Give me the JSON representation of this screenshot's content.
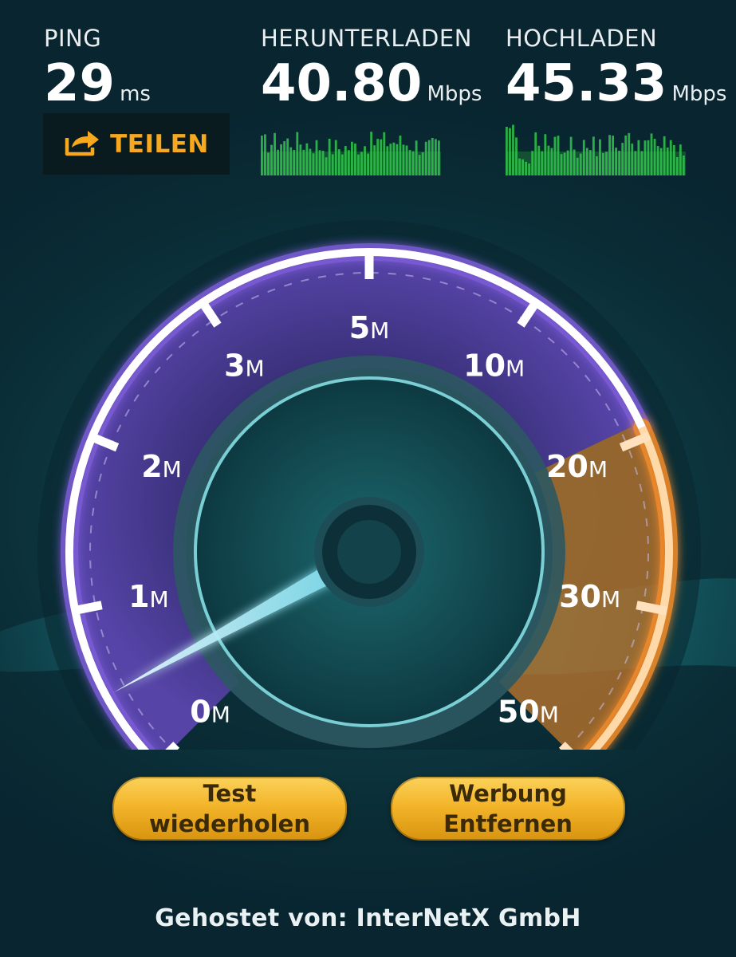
{
  "header": {
    "ping": {
      "label": "PING",
      "value": "29",
      "unit": "ms"
    },
    "download": {
      "label": "HERUNTERLADEN",
      "value": "40.80",
      "unit": "Mbps"
    },
    "upload": {
      "label": "HOCHLADEN",
      "value": "45.33",
      "unit": "Mbps"
    },
    "share": {
      "label": "TEILEN",
      "icon": "share-arrow-icon"
    }
  },
  "gauge": {
    "ticks": [
      {
        "num": "0",
        "unit": "M"
      },
      {
        "num": "1",
        "unit": "M"
      },
      {
        "num": "2",
        "unit": "M"
      },
      {
        "num": "3",
        "unit": "M"
      },
      {
        "num": "5",
        "unit": "M"
      },
      {
        "num": "10",
        "unit": "M"
      },
      {
        "num": "20",
        "unit": "M"
      },
      {
        "num": "30",
        "unit": "M"
      },
      {
        "num": "50",
        "unit": "M"
      }
    ],
    "needle_position": 0.06,
    "colors": {
      "purple": "#7b5bd6",
      "orange": "#f08a2a",
      "needle": "#9ef0ff",
      "bar_green": "#2fbf4a"
    }
  },
  "buttons": {
    "retest": "Test\nwiederholen",
    "remove_ads": "Werbung\nEntfernen"
  },
  "footer": {
    "host": "Gehostet von: InterNetX GmbH"
  }
}
